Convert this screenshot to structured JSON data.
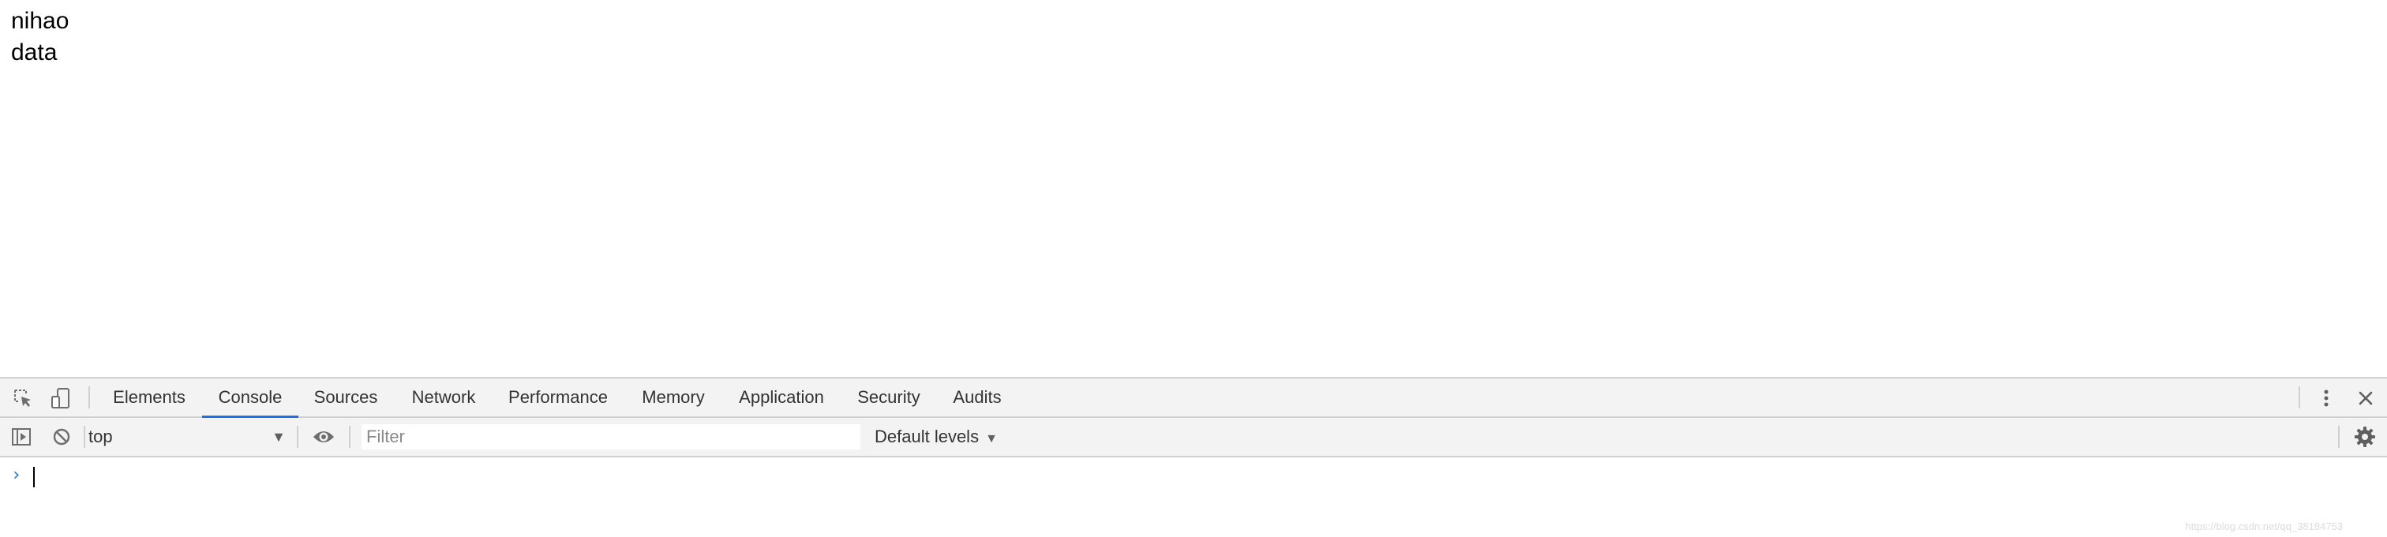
{
  "page": {
    "lines": [
      "nihao",
      "data"
    ]
  },
  "devtools": {
    "tabs": [
      {
        "label": "Elements",
        "active": false
      },
      {
        "label": "Console",
        "active": true
      },
      {
        "label": "Sources",
        "active": false
      },
      {
        "label": "Network",
        "active": false
      },
      {
        "label": "Performance",
        "active": false
      },
      {
        "label": "Memory",
        "active": false
      },
      {
        "label": "Application",
        "active": false
      },
      {
        "label": "Security",
        "active": false
      },
      {
        "label": "Audits",
        "active": false
      }
    ],
    "icons": {
      "inspect": "inspect-element-icon",
      "device": "device-toolbar-icon",
      "more": "more-vertical-icon",
      "close": "close-icon"
    },
    "toolbar": {
      "context_value": "top",
      "filter_placeholder": "Filter",
      "levels_label": "Default levels",
      "icons": {
        "sidebar": "sidebar-toggle-icon",
        "clear": "clear-console-icon",
        "live_expression": "eye-icon",
        "settings": "gear-icon"
      }
    },
    "console": {
      "prompt_symbol": "›"
    },
    "watermark": "https://blog.csdn.net/qq_38184753"
  },
  "colors": {
    "accent": "#1a73e8",
    "toolbar_bg": "#f3f3f3",
    "border": "#d0d0d0"
  }
}
